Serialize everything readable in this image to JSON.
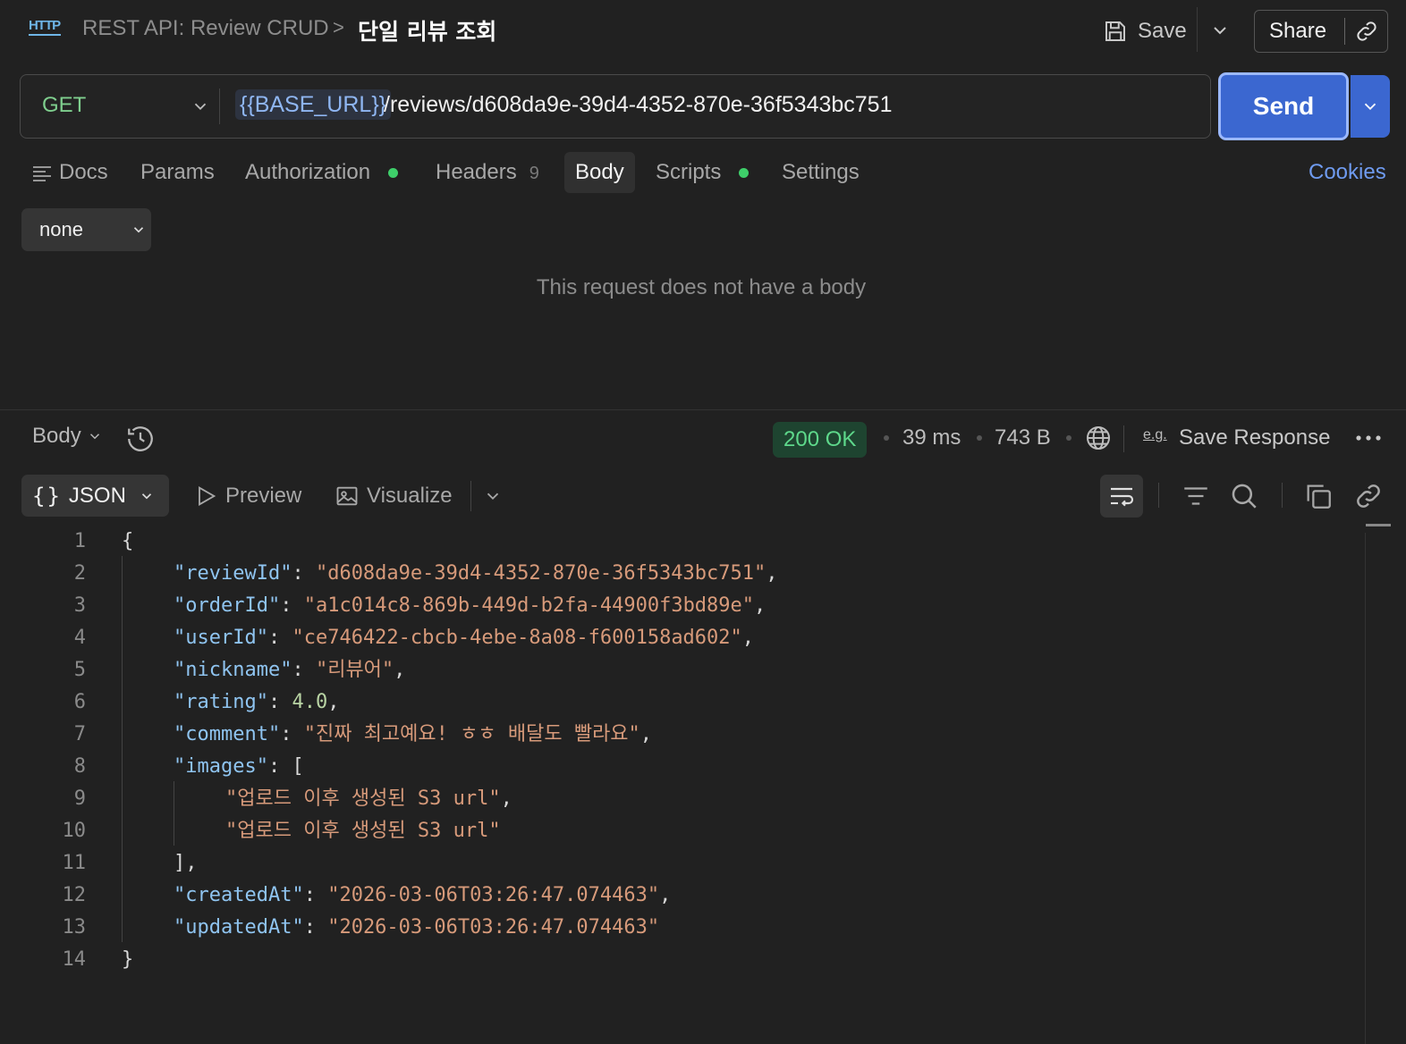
{
  "header": {
    "icon_label": "HTTP",
    "breadcrumb_collection": "REST API: Review CRUD",
    "breadcrumb_separator": ">",
    "request_name": "단일 리뷰 조회",
    "save_label": "Save",
    "share_label": "Share"
  },
  "request": {
    "method": "GET",
    "url_variable": "{{BASE_URL}}",
    "url_path": "/reviews/d608da9e-39d4-4352-870e-36f5343bc751",
    "send_label": "Send"
  },
  "tabs": {
    "docs": "Docs",
    "params": "Params",
    "authorization": "Authorization",
    "headers": "Headers",
    "headers_count": "9",
    "body": "Body",
    "scripts": "Scripts",
    "settings": "Settings",
    "cookies": "Cookies",
    "active": "Body",
    "status_dot_color": "#3ecf6a"
  },
  "request_body": {
    "type": "none",
    "empty_message": "This request does not have a body"
  },
  "response": {
    "section_label": "Body",
    "status": "200 OK",
    "time": "39 ms",
    "size": "743 B",
    "save_response_label": "Save Response",
    "format": "JSON",
    "preview_label": "Preview",
    "visualize_label": "Visualize",
    "status_color": "#5ed88b",
    "lines": [
      {
        "num": "1"
      },
      {
        "num": "2"
      },
      {
        "num": "3"
      },
      {
        "num": "4"
      },
      {
        "num": "5"
      },
      {
        "num": "6"
      },
      {
        "num": "7"
      },
      {
        "num": "8"
      },
      {
        "num": "9"
      },
      {
        "num": "10"
      },
      {
        "num": "11"
      },
      {
        "num": "12"
      },
      {
        "num": "13"
      },
      {
        "num": "14"
      }
    ],
    "json": {
      "reviewId_key": "\"reviewId\"",
      "reviewId_val": "\"d608da9e-39d4-4352-870e-36f5343bc751\"",
      "orderId_key": "\"orderId\"",
      "orderId_val": "\"a1c014c8-869b-449d-b2fa-44900f3bd89e\"",
      "userId_key": "\"userId\"",
      "userId_val": "\"ce746422-cbcb-4ebe-8a08-f600158ad602\"",
      "nickname_key": "\"nickname\"",
      "nickname_val": "\"리뷰어\"",
      "rating_key": "\"rating\"",
      "rating_val": "4.0",
      "comment_key": "\"comment\"",
      "comment_val": "\"진짜 최고예요! ㅎㅎ 배달도 빨라요\"",
      "images_key": "\"images\"",
      "image_1": "\"업로드 이후 생성된 S3 url\"",
      "image_2": "\"업로드 이후 생성된 S3 url\"",
      "createdAt_key": "\"createdAt\"",
      "createdAt_val": "\"2026-03-06T03:26:47.074463\"",
      "updatedAt_key": "\"updatedAt\"",
      "updatedAt_val": "\"2026-03-06T03:26:47.074463\""
    }
  },
  "icons": {
    "http": "http-icon",
    "save": "save-icon",
    "link": "link-icon",
    "docs": "docs-icon",
    "history": "history-icon",
    "globe": "globe-icon",
    "more": "more-icon",
    "preview": "play-icon",
    "visualize": "image-icon",
    "wrap": "wrap-icon",
    "filter": "filter-icon",
    "search": "search-icon",
    "copy": "copy-icon"
  }
}
